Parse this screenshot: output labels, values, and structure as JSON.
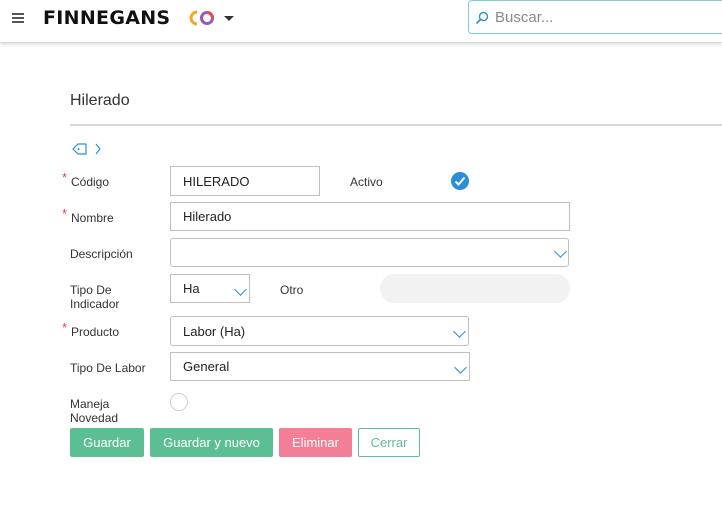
{
  "header": {
    "brand": "FINNEGANS",
    "search_placeholder": "Buscar..."
  },
  "form": {
    "title": "Hilerado",
    "fields": {
      "codigo": {
        "label": "Código",
        "value": "HILERADO"
      },
      "activo": {
        "label": "Activo",
        "checked": true
      },
      "nombre": {
        "label": "Nombre",
        "value": "Hilerado"
      },
      "descripcion": {
        "label": "Descripción",
        "value": ""
      },
      "tipo_indicador": {
        "label_line1": "Tipo De",
        "label_line2": "Indicador",
        "value": "Ha"
      },
      "otro": {
        "label": "Otro",
        "value": ""
      },
      "producto": {
        "label": "Producto",
        "value": "Labor (Ha)"
      },
      "tipo_labor": {
        "label": "Tipo De Labor",
        "value": "General"
      },
      "maneja_novedad": {
        "label_line1": "Maneja",
        "label_line2": "Novedad",
        "checked": false
      }
    },
    "required_marker": "*"
  },
  "actions": {
    "save": "Guardar",
    "save_new": "Guardar y nuevo",
    "delete": "Eliminar",
    "close": "Cerrar"
  },
  "colors": {
    "primary_green": "#5bbf93",
    "danger_pink": "#f47e96",
    "accent_blue": "#2a8fd6",
    "required_red": "#e0414f"
  }
}
